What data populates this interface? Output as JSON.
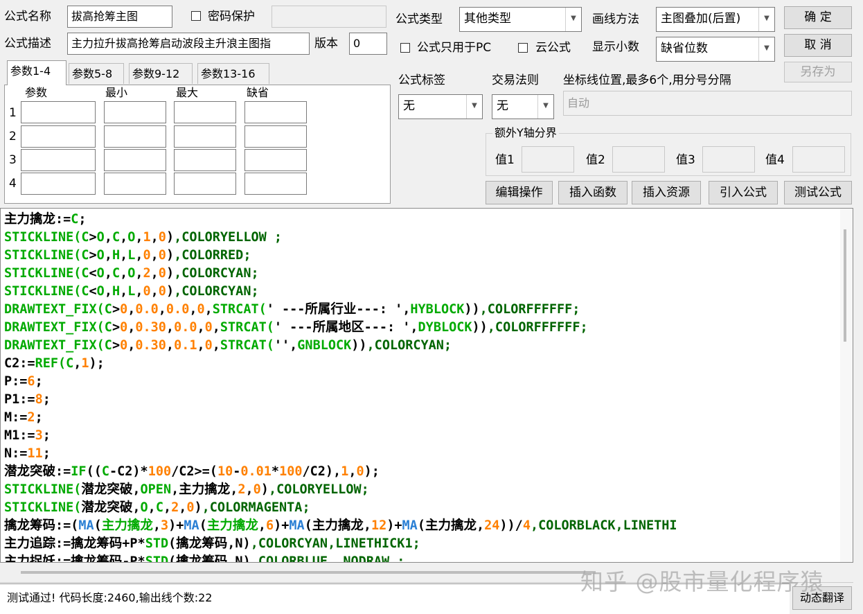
{
  "form": {
    "name_label": "公式名称",
    "name_value": "拔高抢筹主图",
    "password_label": "密码保护",
    "desc_label": "公式描述",
    "desc_value": "主力拉升拔高抢筹启动波段主升浪主图指",
    "version_label": "版本",
    "version_value": "0",
    "type_label": "公式类型",
    "type_value": "其他类型",
    "draw_label": "画线方法",
    "draw_value": "主图叠加(后置)",
    "pc_only_label": "公式只用于PC",
    "cloud_label": "云公式",
    "decimal_label": "显示小数",
    "decimal_value": "缺省位数",
    "tag_label": "公式标签",
    "tag_value": "无",
    "rule_label": "交易法则",
    "rule_value": "无",
    "coord_label": "坐标线位置,最多6个,用分号分隔",
    "coord_value": "自动",
    "extra_y_label": "额外Y轴分界",
    "v1_label": "值1",
    "v2_label": "值2",
    "v3_label": "值3",
    "v4_label": "值4"
  },
  "buttons": {
    "ok": "确  定",
    "cancel": "取  消",
    "save_as": "另存为",
    "edit_ops": "编辑操作",
    "insert_func": "插入函数",
    "insert_res": "插入资源",
    "import_formula": "引入公式",
    "test_formula": "测试公式",
    "dynamic_translate": "动态翻译"
  },
  "params": {
    "tabs": [
      "参数1-4",
      "参数5-8",
      "参数9-12",
      "参数13-16"
    ],
    "headers": [
      "参数",
      "最小",
      "最大",
      "缺省"
    ],
    "rows": [
      "1",
      "2",
      "3",
      "4"
    ]
  },
  "code_lines": [
    [
      [
        "主力擒龙:=",
        "#000000"
      ],
      [
        "C",
        "#00aa00"
      ],
      [
        ";",
        "#000000"
      ]
    ],
    [
      [
        "STICKLINE(",
        "#00aa00"
      ],
      [
        "C",
        "#00aa00"
      ],
      [
        ">",
        "#000000"
      ],
      [
        "O",
        "#00aa00"
      ],
      [
        ",",
        "#000000"
      ],
      [
        "C",
        "#00aa00"
      ],
      [
        ",",
        "#000000"
      ],
      [
        "O",
        "#00aa00"
      ],
      [
        ",",
        "#000000"
      ],
      [
        "1",
        "#ff8000"
      ],
      [
        ",",
        "#000000"
      ],
      [
        "0",
        "#ff8000"
      ],
      [
        ")",
        "#000000"
      ],
      [
        ",COLORYELLOW ;",
        "#006400"
      ]
    ],
    [
      [
        "STICKLINE(",
        "#00aa00"
      ],
      [
        "C",
        "#00aa00"
      ],
      [
        ">",
        "#000000"
      ],
      [
        "O",
        "#00aa00"
      ],
      [
        ",",
        "#000000"
      ],
      [
        "H",
        "#00aa00"
      ],
      [
        ",",
        "#000000"
      ],
      [
        "L",
        "#00aa00"
      ],
      [
        ",",
        "#000000"
      ],
      [
        "0",
        "#ff8000"
      ],
      [
        ",",
        "#000000"
      ],
      [
        "0",
        "#ff8000"
      ],
      [
        ")",
        "#000000"
      ],
      [
        ",COLORRED;",
        "#006400"
      ]
    ],
    [
      [
        "STICKLINE(",
        "#00aa00"
      ],
      [
        "C",
        "#00aa00"
      ],
      [
        "<",
        "#000000"
      ],
      [
        "O",
        "#00aa00"
      ],
      [
        ",",
        "#000000"
      ],
      [
        "C",
        "#00aa00"
      ],
      [
        ",",
        "#000000"
      ],
      [
        "O",
        "#00aa00"
      ],
      [
        ",",
        "#000000"
      ],
      [
        "2",
        "#ff8000"
      ],
      [
        ",",
        "#000000"
      ],
      [
        "0",
        "#ff8000"
      ],
      [
        ")",
        "#000000"
      ],
      [
        ",COLORCYAN;",
        "#006400"
      ]
    ],
    [
      [
        "STICKLINE(",
        "#00aa00"
      ],
      [
        "C",
        "#00aa00"
      ],
      [
        "<",
        "#000000"
      ],
      [
        "O",
        "#00aa00"
      ],
      [
        ",",
        "#000000"
      ],
      [
        "H",
        "#00aa00"
      ],
      [
        ",",
        "#000000"
      ],
      [
        "L",
        "#00aa00"
      ],
      [
        ",",
        "#000000"
      ],
      [
        "0",
        "#ff8000"
      ],
      [
        ",",
        "#000000"
      ],
      [
        "0",
        "#ff8000"
      ],
      [
        ")",
        "#000000"
      ],
      [
        ",COLORCYAN;",
        "#006400"
      ]
    ],
    [
      [
        "DRAWTEXT_FIX(",
        "#00aa00"
      ],
      [
        "C",
        "#00aa00"
      ],
      [
        ">",
        "#000000"
      ],
      [
        "0",
        "#ff8000"
      ],
      [
        ",",
        "#000000"
      ],
      [
        "0.0",
        "#ff8000"
      ],
      [
        ",",
        "#000000"
      ],
      [
        "0.0",
        "#ff8000"
      ],
      [
        ",",
        "#000000"
      ],
      [
        "0",
        "#ff8000"
      ],
      [
        ",",
        "#000000"
      ],
      [
        "STRCAT(",
        "#00aa00"
      ],
      [
        "' ---所属行业---: '",
        "#000000"
      ],
      [
        ",",
        "#000000"
      ],
      [
        "HYBLOCK",
        "#00aa00"
      ],
      [
        "))",
        "#000000"
      ],
      [
        ",COLORFFFFFF;",
        "#006400"
      ]
    ],
    [
      [
        "DRAWTEXT_FIX(",
        "#00aa00"
      ],
      [
        "C",
        "#00aa00"
      ],
      [
        ">",
        "#000000"
      ],
      [
        "0",
        "#ff8000"
      ],
      [
        ",",
        "#000000"
      ],
      [
        "0.30",
        "#ff8000"
      ],
      [
        ",",
        "#000000"
      ],
      [
        "0.0",
        "#ff8000"
      ],
      [
        ",",
        "#000000"
      ],
      [
        "0",
        "#ff8000"
      ],
      [
        ",",
        "#000000"
      ],
      [
        "STRCAT(",
        "#00aa00"
      ],
      [
        "' ---所属地区---: '",
        "#000000"
      ],
      [
        ",",
        "#000000"
      ],
      [
        "DYBLOCK",
        "#00aa00"
      ],
      [
        "))",
        "#000000"
      ],
      [
        ",COLORFFFFFF;",
        "#006400"
      ]
    ],
    [
      [
        "DRAWTEXT_FIX(",
        "#00aa00"
      ],
      [
        "C",
        "#00aa00"
      ],
      [
        ">",
        "#000000"
      ],
      [
        "0",
        "#ff8000"
      ],
      [
        ",",
        "#000000"
      ],
      [
        "0.30",
        "#ff8000"
      ],
      [
        ",",
        "#000000"
      ],
      [
        "0.1",
        "#ff8000"
      ],
      [
        ",",
        "#000000"
      ],
      [
        "0",
        "#ff8000"
      ],
      [
        ",",
        "#000000"
      ],
      [
        "STRCAT(",
        "#00aa00"
      ],
      [
        "''",
        "#000000"
      ],
      [
        ",",
        "#000000"
      ],
      [
        "GNBLOCK",
        "#00aa00"
      ],
      [
        "))",
        "#000000"
      ],
      [
        ",COLORCYAN;",
        "#006400"
      ]
    ],
    [
      [
        "C2:=",
        "#000000"
      ],
      [
        "REF(",
        "#00aa00"
      ],
      [
        "C",
        "#00aa00"
      ],
      [
        ",",
        "#000000"
      ],
      [
        "1",
        "#ff8000"
      ],
      [
        ");",
        "#000000"
      ]
    ],
    [
      [
        "P:=",
        "#000000"
      ],
      [
        "6",
        "#ff8000"
      ],
      [
        ";",
        "#000000"
      ]
    ],
    [
      [
        "P1:=",
        "#000000"
      ],
      [
        "8",
        "#ff8000"
      ],
      [
        ";",
        "#000000"
      ]
    ],
    [
      [
        "M:=",
        "#000000"
      ],
      [
        "2",
        "#ff8000"
      ],
      [
        ";",
        "#000000"
      ]
    ],
    [
      [
        "M1:=",
        "#000000"
      ],
      [
        "3",
        "#ff8000"
      ],
      [
        ";",
        "#000000"
      ]
    ],
    [
      [
        "N:=",
        "#000000"
      ],
      [
        "11",
        "#ff8000"
      ],
      [
        ";",
        "#000000"
      ]
    ],
    [
      [
        "潜龙突破:=",
        "#000000"
      ],
      [
        "IF",
        "#00aa00"
      ],
      [
        "((",
        "#000000"
      ],
      [
        "C",
        "#00aa00"
      ],
      [
        "-C2)*",
        "#000000"
      ],
      [
        "100",
        "#ff8000"
      ],
      [
        "/C2>=(",
        "#000000"
      ],
      [
        "10",
        "#ff8000"
      ],
      [
        "-",
        "#000000"
      ],
      [
        "0.01",
        "#ff8000"
      ],
      [
        "*",
        "#000000"
      ],
      [
        "100",
        "#ff8000"
      ],
      [
        "/C2),",
        "#000000"
      ],
      [
        "1",
        "#ff8000"
      ],
      [
        ",",
        "#000000"
      ],
      [
        "0",
        "#ff8000"
      ],
      [
        ");",
        "#000000"
      ]
    ],
    [
      [
        "STICKLINE(",
        "#00aa00"
      ],
      [
        "潜龙突破,",
        "#000000"
      ],
      [
        "OPEN",
        "#00aa00"
      ],
      [
        ",主力擒龙,",
        "#000000"
      ],
      [
        "2",
        "#ff8000"
      ],
      [
        ",",
        "#000000"
      ],
      [
        "0",
        "#ff8000"
      ],
      [
        ")",
        "#000000"
      ],
      [
        ",COLORYELLOW;",
        "#006400"
      ]
    ],
    [
      [
        "STICKLINE(",
        "#00aa00"
      ],
      [
        "潜龙突破,",
        "#000000"
      ],
      [
        "O",
        "#00aa00"
      ],
      [
        ",",
        "#000000"
      ],
      [
        "C",
        "#00aa00"
      ],
      [
        ",",
        "#000000"
      ],
      [
        "2",
        "#ff8000"
      ],
      [
        ",",
        "#000000"
      ],
      [
        "0",
        "#ff8000"
      ],
      [
        ")",
        "#000000"
      ],
      [
        ",COLORMAGENTA;",
        "#006400"
      ]
    ],
    [
      [
        "擒龙筹码:=(",
        "#000000"
      ],
      [
        "MA",
        "#2a7fd4"
      ],
      [
        "(",
        "#000000"
      ],
      [
        "主力擒龙",
        "#00aa00"
      ],
      [
        ",",
        "#000000"
      ],
      [
        "3",
        "#ff8000"
      ],
      [
        ")+",
        "#000000"
      ],
      [
        "MA",
        "#2a7fd4"
      ],
      [
        "(",
        "#000000"
      ],
      [
        "主力擒龙",
        "#00aa00"
      ],
      [
        ",",
        "#000000"
      ],
      [
        "6",
        "#ff8000"
      ],
      [
        ")+",
        "#000000"
      ],
      [
        "MA",
        "#2a7fd4"
      ],
      [
        "(主力擒龙,",
        "#000000"
      ],
      [
        "12",
        "#ff8000"
      ],
      [
        ")+",
        "#000000"
      ],
      [
        "MA",
        "#2a7fd4"
      ],
      [
        "(主力擒龙,",
        "#000000"
      ],
      [
        "24",
        "#ff8000"
      ],
      [
        "))/",
        "#000000"
      ],
      [
        "4",
        "#ff8000"
      ],
      [
        ",COLORBLACK,LINETHI",
        "#006400"
      ]
    ],
    [
      [
        "主力追踪:=擒龙筹码+P*",
        "#000000"
      ],
      [
        "STD",
        "#00aa00"
      ],
      [
        "(擒龙筹码,N)",
        "#000000"
      ],
      [
        ",COLORCYAN,LINETHICK1;",
        "#006400"
      ]
    ],
    [
      [
        "主力捉妖:=擒龙筹码-P*",
        "#000000"
      ],
      [
        "STD",
        "#00aa00"
      ],
      [
        "(擒龙筹码,N)",
        "#000000"
      ],
      [
        ",COLORBLUE ,NODRAW ;",
        "#006400"
      ]
    ]
  ],
  "status": "测试通过! 代码长度:2460,输出线个数:22",
  "watermark": "知乎 @股市量化程序猿"
}
